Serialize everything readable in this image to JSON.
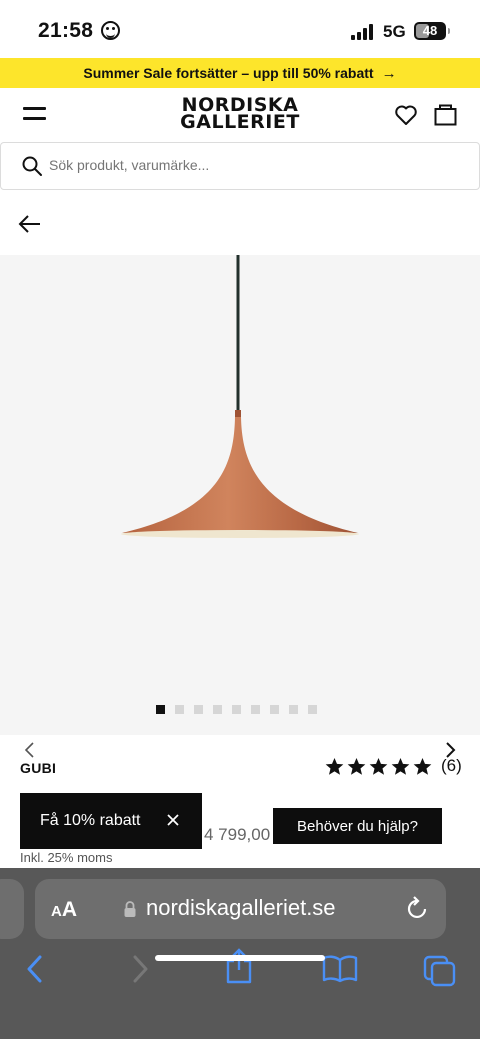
{
  "status": {
    "time": "21:58",
    "network": "5G",
    "battery": "48",
    "battery_level": 0.48
  },
  "promo": {
    "text": "Summer Sale fortsätter – upp till 50% rabatt",
    "arrow": "→"
  },
  "header": {
    "logo_line1": "NORDISKA",
    "logo_line2": "GALLERIET"
  },
  "search": {
    "placeholder": "Sök produkt, varumärke..."
  },
  "gallery": {
    "image_count": 9,
    "active_index": 0,
    "lamp_color": "#c06f4c"
  },
  "product": {
    "brand": "GUBI",
    "stars": 5,
    "review_count": "(6)",
    "price": "4 799,00",
    "vat_note": "Inkl. 25% moms"
  },
  "discount": {
    "label": "Få 10% rabatt"
  },
  "help": {
    "label": "Behöver du hjälp?"
  },
  "safari": {
    "aa_small": "A",
    "aa_large": "A",
    "url": "nordiskagalleriet.se"
  },
  "colors": {
    "promo_bg": "#fde52b",
    "safari_blue": "#4a8ff5",
    "dark": "#0d0d0d"
  }
}
